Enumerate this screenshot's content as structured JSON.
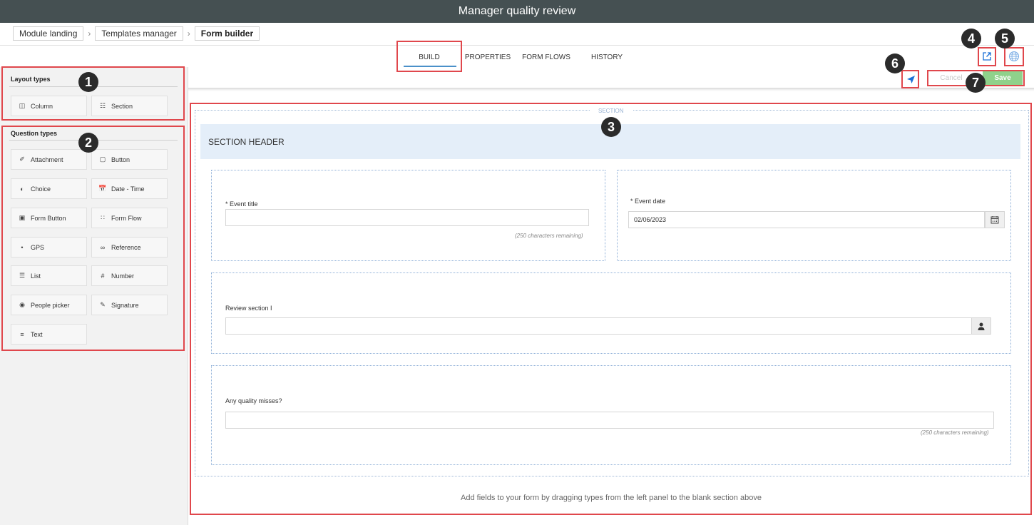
{
  "app": {
    "title": "Manager quality review"
  },
  "breadcrumb": [
    "Module landing",
    "Templates manager",
    "Form builder"
  ],
  "tabs": [
    "BUILD",
    "PROPERTIES",
    "FORM FLOWS",
    "HISTORY"
  ],
  "toolbar": {
    "cancel_label": "Cancel",
    "save_label": "Save"
  },
  "sidebar": {
    "layout_title": "Layout types",
    "layout_items": [
      {
        "label": "Column",
        "icon": "column-icon"
      },
      {
        "label": "Section",
        "icon": "section-icon"
      }
    ],
    "question_title": "Question types",
    "question_items": [
      {
        "label": "Attachment",
        "icon": "paperclip-icon"
      },
      {
        "label": "Button",
        "icon": "checkbox-icon"
      },
      {
        "label": "Choice",
        "icon": "toggle-icon"
      },
      {
        "label": "Date - Time",
        "icon": "calendar-clock-icon"
      },
      {
        "label": "Form Button",
        "icon": "form-button-icon"
      },
      {
        "label": "Form Flow",
        "icon": "flow-icon"
      },
      {
        "label": "GPS",
        "icon": "pin-icon"
      },
      {
        "label": "Reference",
        "icon": "link-icon"
      },
      {
        "label": "List",
        "icon": "list-icon"
      },
      {
        "label": "Number",
        "icon": "hash-icon"
      },
      {
        "label": "People picker",
        "icon": "person-icon"
      },
      {
        "label": "Signature",
        "icon": "signature-icon"
      },
      {
        "label": "Text",
        "icon": "text-icon"
      }
    ]
  },
  "canvas": {
    "section_label": "SECTION",
    "section_header": "SECTION HEADER",
    "fields": {
      "event_title": {
        "label": "Event title",
        "required": "*",
        "value": "",
        "hint": "(250 characters remaining)"
      },
      "event_date": {
        "label": "Event date",
        "required": "*",
        "value": "02/06/2023"
      },
      "review_section": {
        "label": "Review section I",
        "value": ""
      },
      "quality_misses": {
        "label": "Any quality misses?",
        "value": "",
        "hint": "(250 characters remaining)"
      }
    },
    "footer_hint": "Add fields to your form by dragging types from the left panel to the blank section above"
  },
  "annotations": [
    "1",
    "2",
    "3",
    "4",
    "5",
    "6",
    "7"
  ],
  "colors": {
    "titlebar": "#455052",
    "highlight": "#e0474c",
    "save": "#8fd18b",
    "section_header_bg": "#e4eef9",
    "accent": "#1a6fd6"
  }
}
